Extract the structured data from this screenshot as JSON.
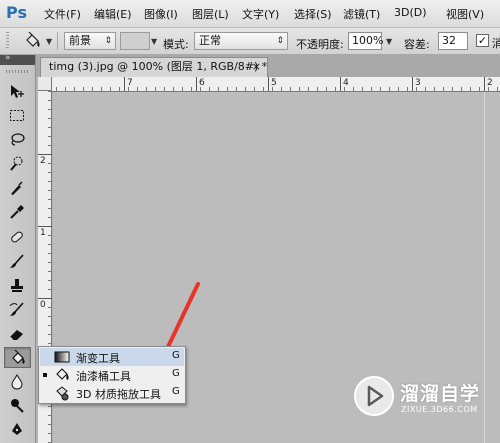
{
  "app": {
    "logo": "Ps"
  },
  "menu": [
    "文件(F)",
    "编辑(E)",
    "图像(I)",
    "图层(L)",
    "文字(Y)",
    "选择(S)",
    "滤镜(T)",
    "3D(D)",
    "视图(V)"
  ],
  "options": {
    "fill_source": "前景",
    "mode_label": "模式:",
    "mode_value": "正常",
    "opacity_label": "不透明度:",
    "opacity_value": "100%",
    "tolerance_label": "容差:",
    "tolerance_value": "32",
    "truncated_check_label": "消"
  },
  "document": {
    "tab_title": "timg (3).jpg @ 100% (图层 1, RGB/8#) *",
    "close_glyph": "×"
  },
  "ruler": {
    "top_labels": [
      "7",
      "6",
      "5",
      "4",
      "3",
      "2"
    ],
    "left_labels": [
      "2",
      "1",
      "0"
    ]
  },
  "tools_panel": {
    "header_glyph": "»",
    "tools": [
      "move-icon",
      "marquee-icon",
      "lasso-icon",
      "quick-select-icon",
      "crop-icon",
      "eyedropper-icon",
      "healing-brush-icon",
      "brush-icon",
      "clone-stamp-icon",
      "history-brush-icon",
      "eraser-icon",
      "paint-bucket-icon",
      "blur-icon",
      "dodge-icon",
      "pen-icon"
    ],
    "active_tool": "paint-bucket-icon"
  },
  "flyout": {
    "items": [
      {
        "label": "渐变工具",
        "shortcut": "G",
        "icon": "gradient-icon",
        "selected": false,
        "highlighted": true
      },
      {
        "label": "油漆桶工具",
        "shortcut": "G",
        "icon": "paint-bucket-icon",
        "selected": true,
        "highlighted": false
      },
      {
        "label": "3D 材质拖放工具",
        "shortcut": "G",
        "icon": "3d-material-drop-icon",
        "selected": false,
        "highlighted": false
      }
    ]
  },
  "annotation": {
    "arrow_color": "#e8332a"
  },
  "watermark": {
    "title": "溜溜自学",
    "subtitle": "ZIXUE.3D66.COM"
  },
  "colors": {
    "ps_blue": "#2c6fb3",
    "flyout_highlight": "#c9d8ea"
  }
}
